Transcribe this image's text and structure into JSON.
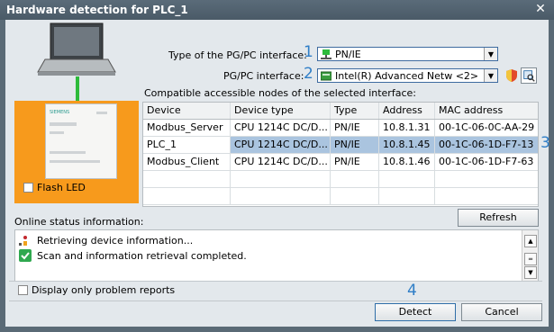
{
  "window": {
    "title": "Hardware detection for PLC_1",
    "close_label": "✕"
  },
  "interface_type": {
    "label": "Type of the PG/PC interface:",
    "value": "PN/IE",
    "marker": "1"
  },
  "pgpc_interface": {
    "label": "PG/PC interface:",
    "value": "Intel(R) Advanced Netw <2>",
    "marker": "2"
  },
  "nodes": {
    "label": "Compatible accessible nodes of the selected interface:",
    "columns": [
      "Device",
      "Device type",
      "Type",
      "Address",
      "MAC address"
    ],
    "rows": [
      [
        "Modbus_Server",
        "CPU 1214C DC/D...",
        "PN/IE",
        "10.8.1.31",
        "00-1C-06-0C-AA-29"
      ],
      [
        "PLC_1",
        "CPU 1214C DC/D...",
        "PN/IE",
        "10.8.1.45",
        "00-1C-06-1D-F7-13"
      ],
      [
        "Modbus_Client",
        "CPU 1214C DC/D...",
        "PN/IE",
        "10.8.1.46",
        "00-1C-06-1D-F7-63"
      ]
    ],
    "selected_marker": "3"
  },
  "flash_led": {
    "label": "Flash LED"
  },
  "plc_brand": "SIEMENS",
  "refresh_button": "Refresh",
  "status": {
    "label": "Online status information:",
    "lines": [
      "Retrieving device information...",
      "Scan and information retrieval completed."
    ]
  },
  "problem_reports": {
    "label": "Display only problem reports"
  },
  "detect_marker": "4",
  "detect_button": "Detect",
  "cancel_button": "Cancel",
  "colors": {
    "accent": "#2f7ec7",
    "panel": "#f79a1c",
    "selected_row": "#aac4df",
    "link_green": "#2dbb3b"
  }
}
